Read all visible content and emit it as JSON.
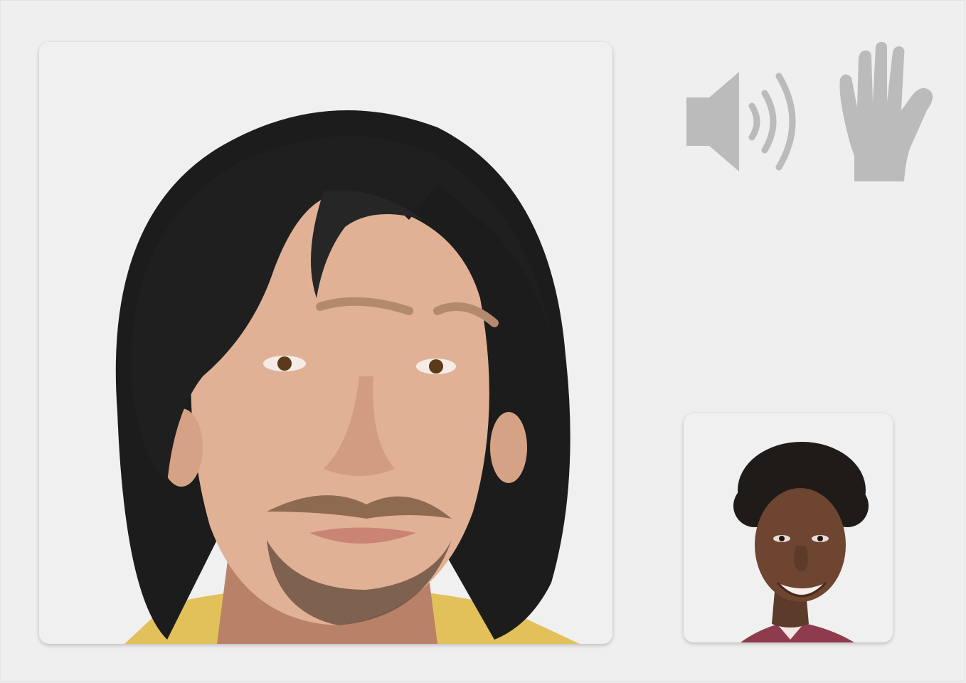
{
  "colors": {
    "background": "#efefef",
    "tile": "#f0f0f0",
    "icon": "#bbbbbb"
  },
  "participants": {
    "main": {
      "role": "remote-participant",
      "video": "on"
    },
    "self": {
      "role": "self-view",
      "video": "on"
    }
  },
  "controls": [
    {
      "icon": "speaker-volume-icon",
      "state": "on"
    },
    {
      "icon": "raise-hand-icon",
      "state": "available"
    }
  ]
}
